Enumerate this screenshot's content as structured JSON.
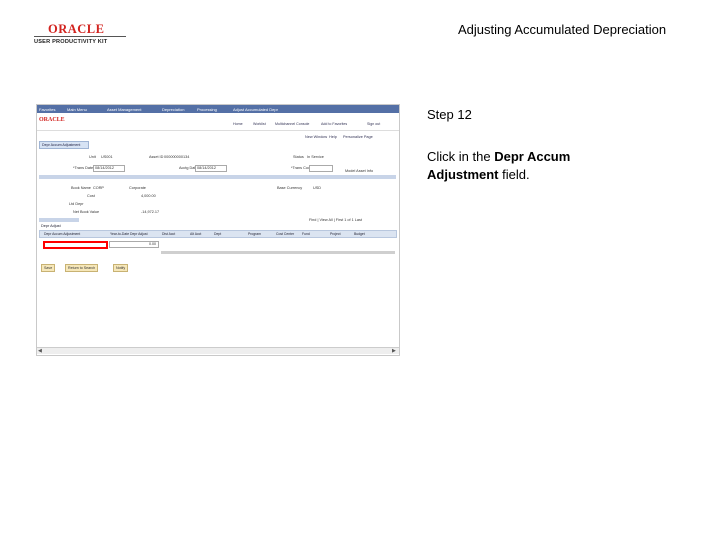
{
  "header": {
    "logo_word": "ORACLE",
    "logo_sub": "USER PRODUCTIVITY KIT",
    "title": "Adjusting Accumulated Depreciation"
  },
  "step": {
    "label": "Step 12"
  },
  "instruction": {
    "prefix": "Click in the ",
    "field": "Depr Accum Adjustment",
    "suffix": " field."
  },
  "screenshot": {
    "brand": "ORACLE",
    "breadcrumb": [
      "Favorites",
      "Main Menu",
      "Asset Management",
      "Depreciation",
      "Processing",
      "Adjust Accumulated Depr"
    ],
    "header_links": [
      "Home",
      "Worklist",
      "Multichannel Console",
      "Add to Favorites",
      "Sign out"
    ],
    "top_links": [
      "New Window",
      "Help",
      "Personalize Page"
    ],
    "page_tab": "Depr Accum Adjustment",
    "fields": {
      "unit_label": "Unit",
      "unit_value": "US001",
      "asset_label": "Asset ID",
      "asset_value": "000000000134",
      "status_label": "Status",
      "status_value": "In Service",
      "trans_date_label": "*Trans Date",
      "trans_date_value": "08/14/2012",
      "acctg_date_label": "Acctg Date",
      "acctg_date_value": "08/14/2012",
      "trans_code_label": "*Trans Code",
      "model_label": "Model Asset Info",
      "book_label": "Book Name",
      "book_value": "CORP",
      "book_desc": "Corporate",
      "base_currency_label": "Base Currency",
      "base_currency_value": "USD",
      "cost_label": "Cost",
      "cost_value": "4,000.00",
      "ltd_label": "Ltd Depr",
      "net_label": "Net Book Value",
      "net_value": "-14,972.17"
    },
    "grid": {
      "title": "Find | View All | First 1 of 1 Last",
      "tabs": "Depr Adjust",
      "columns": [
        "Depr Accum Adjustment",
        "Year-to-Date Depr Adjust",
        "Dist Acct",
        "Alt Acct",
        "Dept",
        "Program",
        "Cost Center",
        "Fund",
        "Project",
        "Budget"
      ],
      "row_value": "0.00"
    },
    "buttons": [
      "Save",
      "Return to Search",
      "Notify"
    ]
  }
}
